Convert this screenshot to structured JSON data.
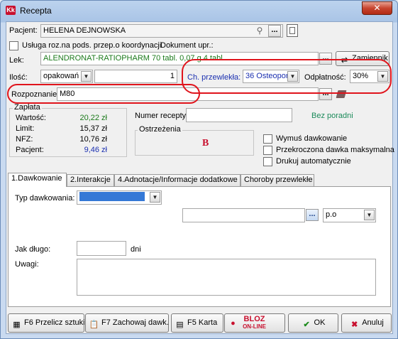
{
  "window": {
    "title": "Recepta",
    "app_icon_text": "Kk",
    "close_glyph": "✕"
  },
  "patient": {
    "label": "Pacjent:",
    "value": "HELENA DEJNOWSKA"
  },
  "service_row": {
    "checkbox_label": "Usługa roz.na pods. przep.o koordynacji",
    "document_label": "Dokument upr.:"
  },
  "drug": {
    "label": "Lek:",
    "value": "ALENDRONAT-RATIOPHARM 70 tabl. 0,07 g 4 tabl",
    "replacement_button": "Zamiennik"
  },
  "quantity": {
    "label": "Ilość:",
    "unit": "opakowań",
    "value": "1"
  },
  "chronic": {
    "label": "Ch. przewlekła:",
    "value": "36 Osteopor"
  },
  "payment": {
    "label": "Odpłatność:",
    "value": "30%"
  },
  "diagnosis": {
    "label": "Rozpoznanie:",
    "value": "M80"
  },
  "charge": {
    "title": "Zapłata",
    "rows": [
      {
        "label": "Wartość:",
        "value": "20,22 zł",
        "color": "#1b7a1b"
      },
      {
        "label": "Limit:",
        "value": "15,37 zł",
        "color": "#000000"
      },
      {
        "label": "NFZ:",
        "value": "10,76 zł",
        "color": "#000000"
      },
      {
        "label": "Pacjent:",
        "value": "9,46 zł",
        "color": "#1a2fb0"
      }
    ]
  },
  "prescription_number": {
    "label": "Numer recepty:",
    "value": ""
  },
  "no_clinic": "Bez poradni",
  "warnings": {
    "title": "Ostrzeżenia",
    "text": "B"
  },
  "options": [
    "Wymuś dawkowanie",
    "Przekroczona dawka maksymalna",
    "Drukuj automatycznie"
  ],
  "tabs": [
    "1.Dawkowanie",
    "2.Interakcje",
    "4.Adnotacje/Informacje dodatkowe",
    "Choroby przewlekłe"
  ],
  "dosage": {
    "type_label": "Typ dawkowania:",
    "type_value": "",
    "route_value": "p.o",
    "how_long_label": "Jak długo:",
    "days_unit": "dni",
    "notes_label": "Uwagi:"
  },
  "buttons": {
    "recalc": "F6 Przelicz sztuki",
    "save_dosage": "F7 Zachowaj dawk.",
    "card": "F5 Karta",
    "bloz_top": "BLOZ",
    "bloz_bottom": "ON-LINE",
    "ok": "OK",
    "cancel": "Anuluj"
  },
  "colors": {
    "annotation_red": "#e0141c",
    "chronic_label": "#1a2fb0",
    "no_clinic": "#1b8a5a"
  }
}
